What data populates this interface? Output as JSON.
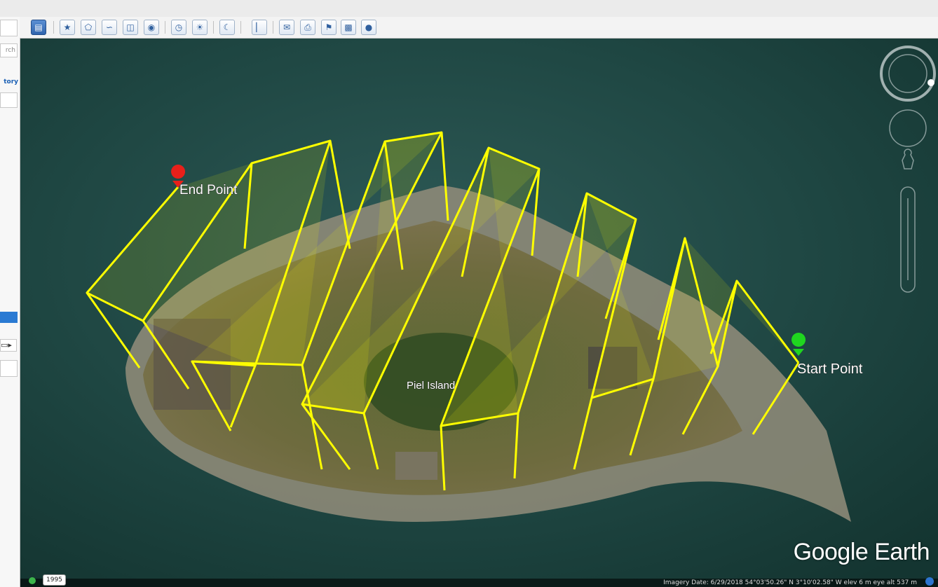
{
  "left_panel": {
    "search_label": "rch",
    "history_label": "tory"
  },
  "map": {
    "labels": {
      "end_point": "End Point",
      "start_point": "Start Point",
      "island": "Piel Island"
    },
    "logo": "Google Earth",
    "path_color": "#ffff00",
    "end_marker_color": "#e8201a",
    "start_marker_color": "#1fd61f"
  },
  "status": {
    "elevation": "1995",
    "info": "Imagery Date: 6/29/2018    54°03'50.26\" N    3°10'02.58\" W    elev    6 m    eye alt  537 m"
  },
  "icons": [
    "sidebar-toggle-icon",
    "placemark-icon",
    "polygon-icon",
    "path-icon",
    "overlay-icon",
    "tour-icon",
    "historical-imagery-icon",
    "sunlight-icon",
    "planets-icon",
    "ruler-icon",
    "email-icon",
    "print-icon",
    "view-in-maps-icon",
    "save-image-icon",
    "globe-icon",
    "compass-icon",
    "look-joystick-icon",
    "street-view-pegman-icon",
    "zoom-slider-icon"
  ]
}
